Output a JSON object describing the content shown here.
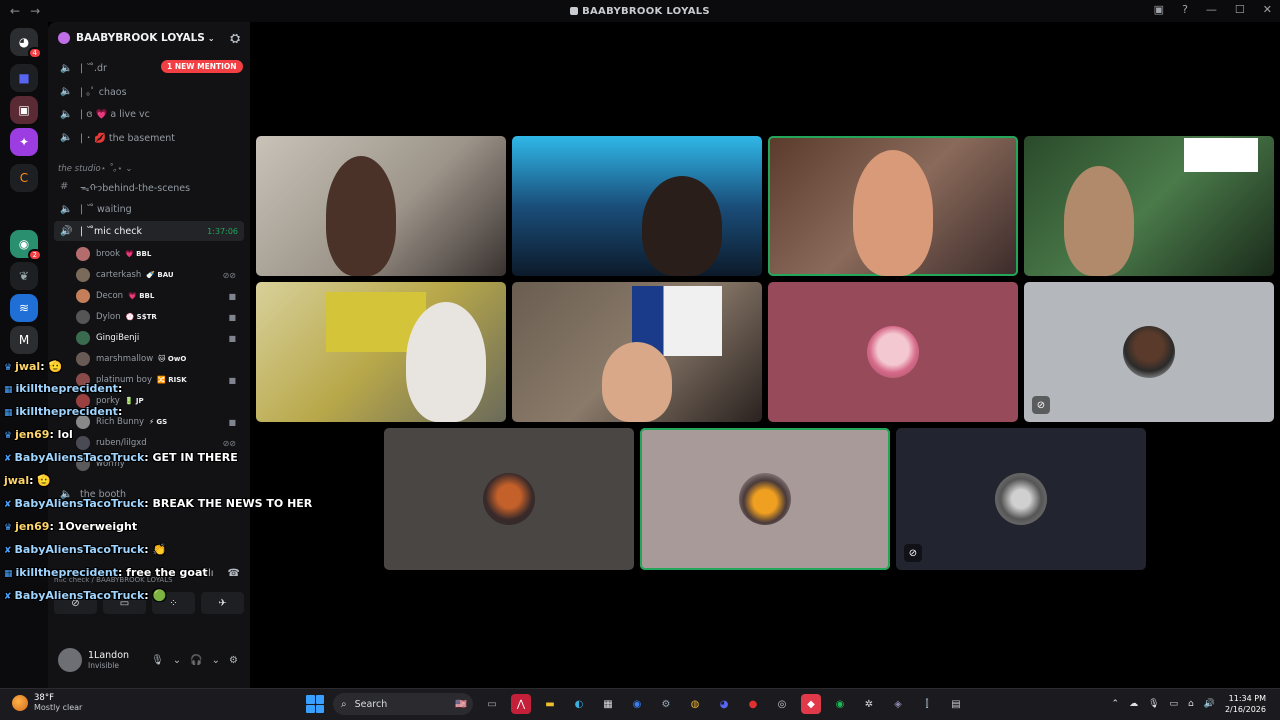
{
  "window": {
    "title": "BAABYBROOK LOYALS"
  },
  "rail": {
    "discord_badge": "4",
    "server_badge": "2"
  },
  "sidebar": {
    "server_name": "BAABYBROOK LOYALS",
    "new_mention": "1 NEW MENTION",
    "channels": [
      {
        "name": "| ˘ ̊.dr"
      },
      {
        "name": "| ｡ﾟ chaos"
      },
      {
        "name": "| ɞ 💗 a live vc"
      },
      {
        "name": "| ･ 💋 the basement"
      }
    ],
    "category": "the studio⋆ ˚｡⋆",
    "channels2": [
      {
        "name": "ᯓᡣ𐭩behind-the-scenes"
      },
      {
        "name": "| ˘ ̊ waiting"
      },
      {
        "name": "| ˘ ̊mic check",
        "timer": "1:37:06"
      }
    ],
    "voice_users": [
      {
        "name": "brook",
        "tag": "💗 BBL"
      },
      {
        "name": "carterkash",
        "tag": "🍼 BAU"
      },
      {
        "name": "Decon",
        "tag": "💗 BBL"
      },
      {
        "name": "Dylon",
        "tag": "💮 S$TR"
      },
      {
        "name": "GingiBenji",
        "tag": ""
      },
      {
        "name": "marshmallow",
        "tag": "🐱 OwO"
      },
      {
        "name": "platinum boy",
        "tag": "🔀 RISK"
      },
      {
        "name": "porky",
        "tag": "🔋 JP"
      },
      {
        "name": "Rich Bunny",
        "tag": "⚡ GS"
      },
      {
        "name": "ruben/lilgxd",
        "tag": ""
      },
      {
        "name": "wormy",
        "tag": ""
      }
    ],
    "more_channels": [
      {
        "name": "the booth"
      }
    ]
  },
  "voice_panel": {
    "subtitle": "mic check / BAABYBROOK LOYALS"
  },
  "user_panel": {
    "username": "1Landon",
    "status": "Invisible"
  },
  "chat": [
    {
      "user": "jwal",
      "text": ": 🫡",
      "style": "gold"
    },
    {
      "user": "ikilltheprесident",
      "text": ":",
      "style": "blue"
    },
    {
      "user": "ikilltheprесident",
      "text": ":",
      "style": "blue"
    },
    {
      "user": "jen69",
      "text": ": lol",
      "style": "gold"
    },
    {
      "user": "BabyAliensTacoTruck",
      "text": ": GET IN THERE",
      "style": "blue"
    },
    {
      "user": "jwal",
      "text": ": 🫡",
      "style": "gold"
    },
    {
      "user": "BabyAliensTacoTruck",
      "text": ": BREAK THE NEWS TO HER",
      "style": "blue"
    },
    {
      "user": "jen69",
      "text": ": 1Overweight",
      "style": "gold"
    },
    {
      "user": "BabyAliensTacoTruck",
      "text": ": 👏",
      "style": "blue"
    },
    {
      "user": "ikilltheprесident",
      "text": ": free the goat",
      "style": "blue"
    },
    {
      "user": "BabyAliensTacoTruck",
      "text": ": 🟢",
      "style": "blue"
    }
  ],
  "taskbar": {
    "temp": "38°F",
    "condition": "Mostly clear",
    "search": "Search",
    "time": "11:34 PM",
    "date": "2/16/2026"
  },
  "colors": {
    "speaking": "#23a55a",
    "mention": "#f23f43",
    "accent": "#5865f2"
  }
}
